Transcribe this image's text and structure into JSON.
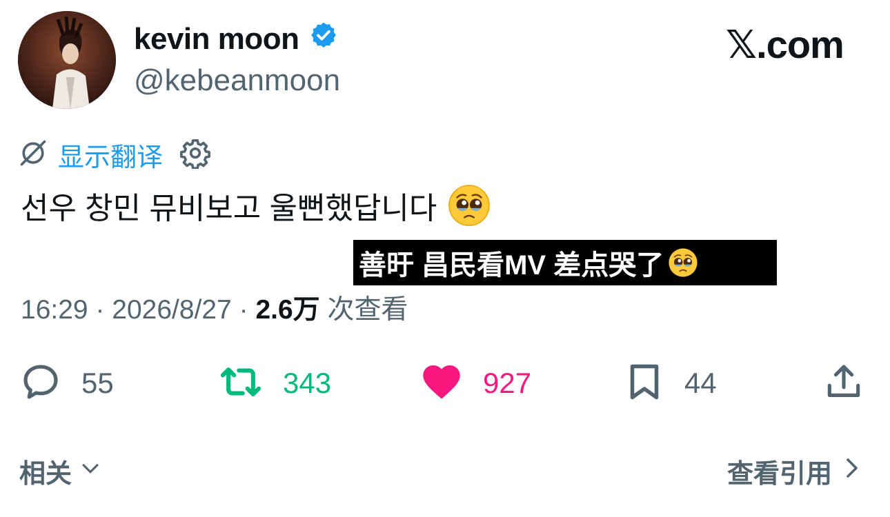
{
  "author": {
    "display_name": "kevin moon",
    "handle": "@kebeanmoon",
    "verified_icon": "verified-badge-icon",
    "avatar_icon": "avatar"
  },
  "site": {
    "logo_text": "𝕏.com"
  },
  "translate": {
    "label": "显示翻译",
    "icons": [
      "translate-slash-icon",
      "gear-icon"
    ]
  },
  "tweet": {
    "text": "선우 창민 뮤비보고 울뻔했답니다",
    "emoji_icon": "pleading-face-emoji-icon"
  },
  "subtitle": {
    "text": "善旴 昌民看MV 差点哭了"
  },
  "meta": {
    "time": "16:29",
    "date": "2026/8/27",
    "sep": " · ",
    "views": "2.6万",
    "views_label": " 次查看"
  },
  "actions": {
    "reply": {
      "count": "55",
      "icon": "reply-icon"
    },
    "retweet": {
      "count": "343",
      "icon": "retweet-icon"
    },
    "like": {
      "count": "927",
      "icon": "heart-icon"
    },
    "bookmark": {
      "count": "44",
      "icon": "bookmark-icon"
    },
    "share": {
      "icon": "share-icon"
    }
  },
  "footer": {
    "related_label": "相关",
    "view_quotes_label": "查看引用"
  },
  "colors": {
    "accent": "#1d9bf0",
    "retweet": "#00ba7c",
    "like": "#f91880",
    "muted": "#536471",
    "text": "#0f1419"
  }
}
